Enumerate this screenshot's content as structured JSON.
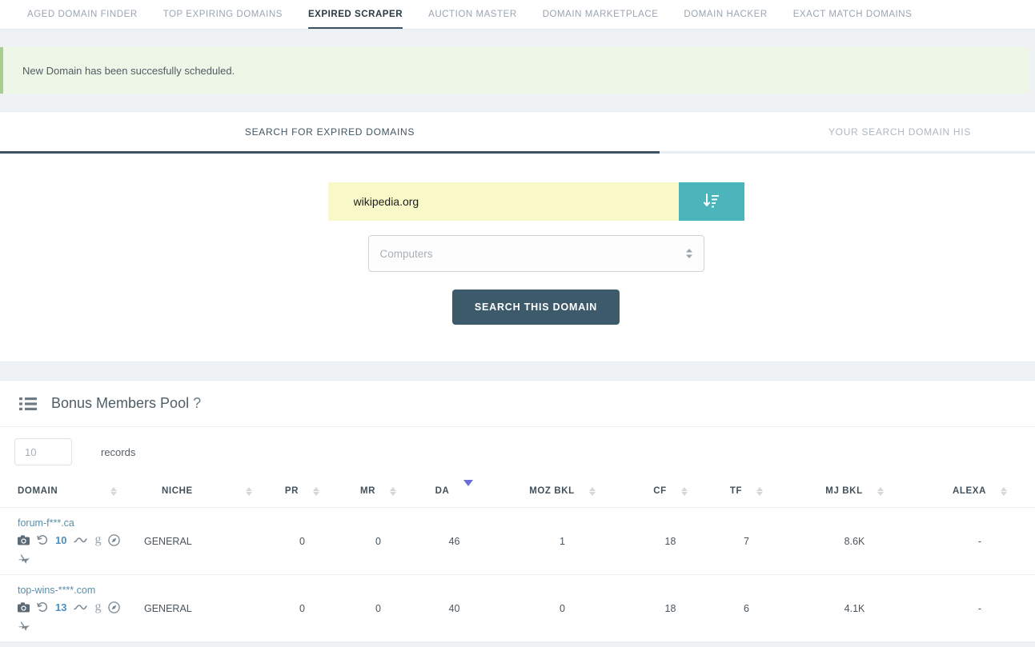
{
  "topnav": {
    "items": [
      {
        "label": "AGED DOMAIN FINDER",
        "active": false
      },
      {
        "label": "TOP EXPIRING DOMAINS",
        "active": false
      },
      {
        "label": "EXPIRED SCRAPER",
        "active": true
      },
      {
        "label": "AUCTION MASTER",
        "active": false
      },
      {
        "label": "DOMAIN MARKETPLACE",
        "active": false
      },
      {
        "label": "DOMAIN HACKER",
        "active": false
      },
      {
        "label": "EXACT MATCH DOMAINS",
        "active": false
      }
    ]
  },
  "alert": {
    "message": "New Domain has been succesfully scheduled.",
    "accent_color": "#a6cf8f",
    "background": "#eef6e8"
  },
  "tabs": [
    {
      "label": "SEARCH FOR EXPIRED DOMAINS",
      "active": true
    },
    {
      "label": "YOUR SEARCH DOMAIN HIS",
      "active": false
    }
  ],
  "search": {
    "domain_value": "wikipedia.org",
    "domain_placeholder": "Enter a domain",
    "sort_button_icon": "sort-amount-down-icon",
    "sort_button_color": "#4cb4bb",
    "niche_selected": "Computers",
    "niche_options": [
      "Computers"
    ],
    "submit_label": "SEARCH THIS DOMAIN",
    "submit_color": "#3c5a69",
    "input_background": "#f8f8c8"
  },
  "pool": {
    "icon": "list-icon",
    "title": "Bonus Members Pool",
    "help_marker": "?",
    "records_value": "10",
    "records_label": "records",
    "sorted_column": "DA",
    "sort_direction": "desc",
    "sort_active_color": "#6b6fd4",
    "columns": [
      {
        "label": "DOMAIN",
        "sortable": true
      },
      {
        "label": "NICHE",
        "sortable": true
      },
      {
        "label": "PR",
        "sortable": true
      },
      {
        "label": "MR",
        "sortable": true
      },
      {
        "label": "DA",
        "sortable": true
      },
      {
        "label": "MOZ BKL",
        "sortable": true
      },
      {
        "label": "CF",
        "sortable": true
      },
      {
        "label": "TF",
        "sortable": true
      },
      {
        "label": "MJ BKL",
        "sortable": true
      },
      {
        "label": "ALEXA",
        "sortable": true
      }
    ],
    "rows": [
      {
        "domain": "forum-f***.ca",
        "count": "10",
        "icons": [
          "camera-icon",
          "history-icon",
          "trend-line-icon",
          "google-g-icon",
          "compass-icon",
          "airplane-icon"
        ],
        "niche": "GENERAL",
        "pr": "0",
        "mr": "0",
        "da": "46",
        "moz_bkl": "1",
        "cf": "18",
        "tf": "7",
        "mj_bkl": "8.6K",
        "alexa": "-"
      },
      {
        "domain": "top-wins-****.com",
        "count": "13",
        "icons": [
          "camera-icon",
          "history-icon",
          "trend-line-icon",
          "google-g-icon",
          "compass-icon",
          "airplane-icon"
        ],
        "niche": "GENERAL",
        "pr": "0",
        "mr": "0",
        "da": "40",
        "moz_bkl": "0",
        "cf": "18",
        "tf": "6",
        "mj_bkl": "4.1K",
        "alexa": "-"
      }
    ]
  }
}
